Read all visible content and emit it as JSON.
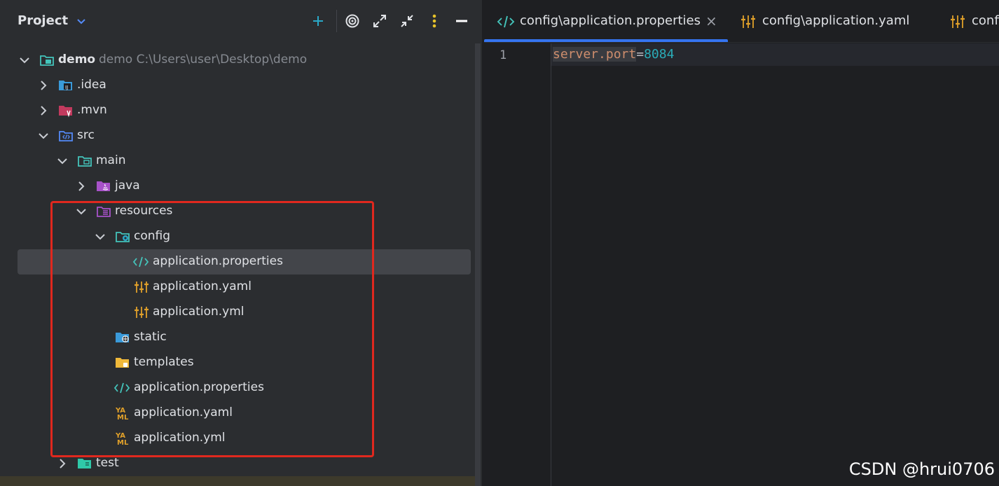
{
  "panel": {
    "title": "Project"
  },
  "tree": [
    {
      "label": "demo",
      "sub": "demo  C:\\Users\\user\\Desktop\\demo",
      "bold": true
    },
    {
      "label": ".idea"
    },
    {
      "label": ".mvn"
    },
    {
      "label": "src"
    },
    {
      "label": "main"
    },
    {
      "label": "java"
    },
    {
      "label": "resources"
    },
    {
      "label": "config"
    },
    {
      "label": "application.properties"
    },
    {
      "label": "application.yaml"
    },
    {
      "label": "application.yml"
    },
    {
      "label": "static"
    },
    {
      "label": "templates"
    },
    {
      "label": "application.properties"
    },
    {
      "label": "application.yaml"
    },
    {
      "label": "application.yml"
    },
    {
      "label": "test"
    }
  ],
  "tabs": [
    {
      "label": "config\\application.properties",
      "active": true
    },
    {
      "label": "config\\application.yaml"
    },
    {
      "label": "confi"
    }
  ],
  "editor": {
    "line_number": "1",
    "key": "server.port",
    "eq": "=",
    "value": "8084"
  },
  "watermark": "CSDN @hrui0706",
  "colors": {
    "accent": "#3574f0",
    "highlight_box": "#e0281e",
    "selection": "#43454a"
  }
}
